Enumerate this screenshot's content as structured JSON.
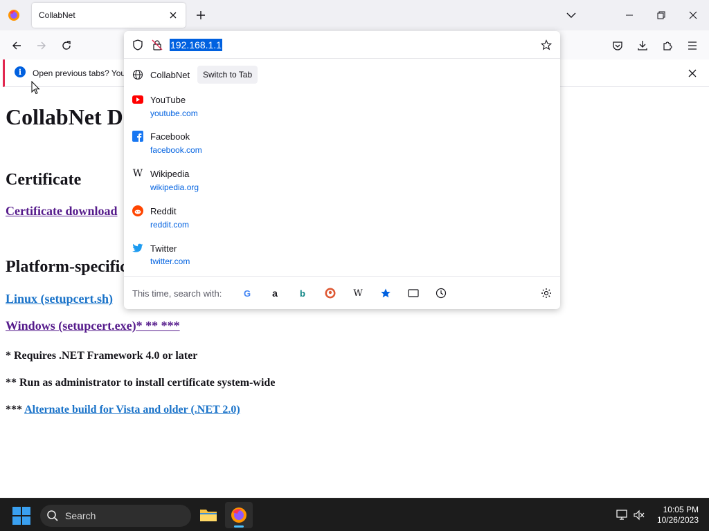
{
  "browser": {
    "tab_title": "CollabNet",
    "url": "192.168.1.1"
  },
  "notification": {
    "text": "Open previous tabs? You"
  },
  "page": {
    "heading": "CollabNet D",
    "section_certificate": "Certificate",
    "certificate_link": "Certificate download",
    "section_platform": "Platform-specific",
    "linux_link": "Linux (setupcert.sh)",
    "windows_link": "Windows (setupcert.exe)",
    "windows_link_suffix": "* ** ***",
    "note1": "* Requires .NET Framework 4.0 or later",
    "note2": "** Run as administrator to install certificate system-wide",
    "note3_prefix": "***",
    "note3_link": "Alternate build for Vista and older (.NET 2.0)"
  },
  "dropdown": {
    "open_tab": {
      "title": "CollabNet",
      "switch_label": "Switch to Tab"
    },
    "suggestions": [
      {
        "title": "YouTube",
        "url": "youtube.com",
        "icon": "youtube-icon"
      },
      {
        "title": "Facebook",
        "url": "facebook.com",
        "icon": "facebook-icon"
      },
      {
        "title": "Wikipedia",
        "url": "wikipedia.org",
        "icon": "wikipedia-icon"
      },
      {
        "title": "Reddit",
        "url": "reddit.com",
        "icon": "reddit-icon"
      },
      {
        "title": "Twitter",
        "url": "twitter.com",
        "icon": "twitter-icon"
      }
    ],
    "search_with_label": "This time, search with:",
    "engines": [
      "google-icon",
      "amazon-icon",
      "bing-icon",
      "duckduckgo-icon",
      "wikipedia-icon",
      "bookmarks-icon",
      "tabs-icon",
      "history-icon"
    ]
  },
  "taskbar": {
    "search_placeholder": "Search",
    "time": "10:05 PM",
    "date": "10/26/2023"
  },
  "colors": {
    "selection": "#0061e0",
    "visited_link": "#551a8b",
    "link": "#1a73c9",
    "taskbar": "#1c1c1c"
  }
}
